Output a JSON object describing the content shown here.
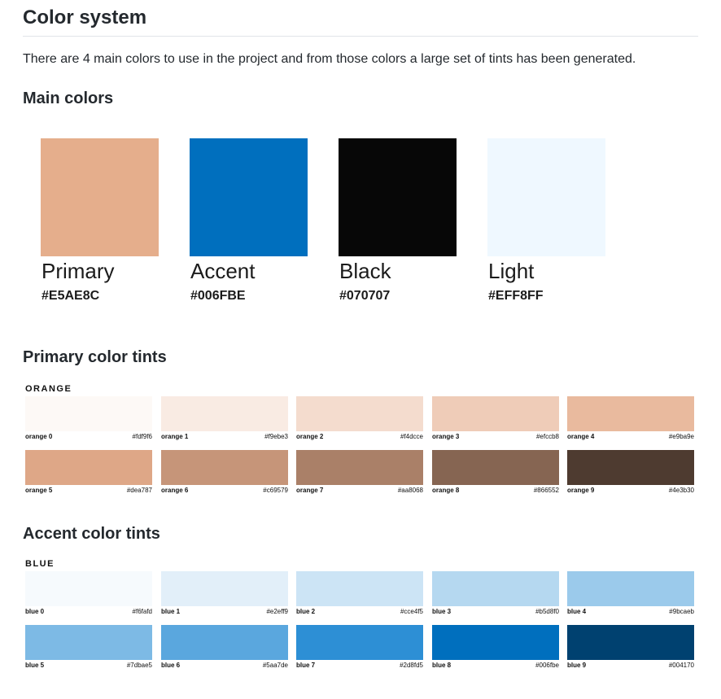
{
  "title": "Color system",
  "intro": "There are 4 main colors to use in the project and from those colors a large set of tints has been generated.",
  "main": {
    "heading": "Main colors",
    "colors": [
      {
        "name": "Primary",
        "hex": "#E5AE8C"
      },
      {
        "name": "Accent",
        "hex": "#006FBE"
      },
      {
        "name": "Black",
        "hex": "#070707"
      },
      {
        "name": "Light",
        "hex": "#EFF8FF"
      }
    ]
  },
  "primary_tints": {
    "heading": "Primary color tints",
    "group": "ORANGE",
    "tints": [
      {
        "name": "orange 0",
        "hex": "#fdf9f6"
      },
      {
        "name": "orange 1",
        "hex": "#f9ebe3"
      },
      {
        "name": "orange 2",
        "hex": "#f4dcce"
      },
      {
        "name": "orange 3",
        "hex": "#efccb8"
      },
      {
        "name": "orange 4",
        "hex": "#e9ba9e"
      },
      {
        "name": "orange 5",
        "hex": "#dea787"
      },
      {
        "name": "orange 6",
        "hex": "#c69579"
      },
      {
        "name": "orange 7",
        "hex": "#aa8068"
      },
      {
        "name": "orange 8",
        "hex": "#866552"
      },
      {
        "name": "orange 9",
        "hex": "#4e3b30"
      }
    ]
  },
  "accent_tints": {
    "heading": "Accent color tints",
    "group": "BLUE",
    "tints": [
      {
        "name": "blue 0",
        "hex": "#f6fafd"
      },
      {
        "name": "blue 1",
        "hex": "#e2eff9"
      },
      {
        "name": "blue 2",
        "hex": "#cce4f5"
      },
      {
        "name": "blue 3",
        "hex": "#b5d8f0"
      },
      {
        "name": "blue 4",
        "hex": "#9bcaeb"
      },
      {
        "name": "blue 5",
        "hex": "#7dbae5"
      },
      {
        "name": "blue 6",
        "hex": "#5aa7de"
      },
      {
        "name": "blue 7",
        "hex": "#2d8fd5"
      },
      {
        "name": "blue 8",
        "hex": "#006fbe"
      },
      {
        "name": "blue 9",
        "hex": "#004170"
      }
    ]
  }
}
